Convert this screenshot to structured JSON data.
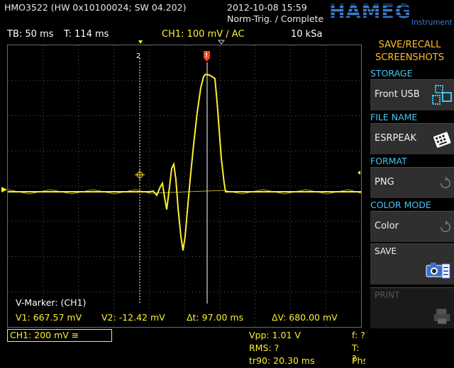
{
  "header": {
    "model": "HMO3522 (HW 0x10100024; SW 04.202)",
    "datetime": "2012-10-08 15:59",
    "trigger_status": "Norm-Trig. / Complete",
    "brand": "HAMEG",
    "brand_sub": "Instruments"
  },
  "info_bar": {
    "timebase": "TB: 50 ms",
    "trigger_time": "T: 114 ms",
    "channel": "CH1: 100 mV ∕ AC",
    "samplerate": "10 kSa"
  },
  "markers": {
    "title": "V-Marker: (CH1)",
    "v1": "V1: 667.57 mV",
    "v2": "V2: -12.42 mV",
    "dt": "Δt: 97.00 ms",
    "dv": "ΔV: 680.00 mV",
    "marker2_label": "2",
    "ch_label": "1"
  },
  "bottom": {
    "ch1_setting": "CH1: 200 mV ≅",
    "vpp": "Vpp: 1.01 V",
    "rms": "RMS: ?",
    "tr90": "tr90: 20.30 ms",
    "freq": "f: ?",
    "period": "T: ?",
    "phase": "Phs: ?"
  },
  "menu": {
    "title1": "SAVE/RECALL",
    "title2": "SCREENSHOTS",
    "storage_label": "STORAGE",
    "storage_value": "Front USB",
    "filename_label": "FILE NAME",
    "filename_value": "ESRPEAK",
    "format_label": "FORMAT",
    "format_value": "PNG",
    "colormode_label": "COLOR MODE",
    "colormode_value": "Color",
    "save_label": "SAVE",
    "print_label": "PRINT"
  },
  "colors": {
    "trace": "#ffef2e",
    "menu_title": "#ffbd28",
    "menu_section": "#46c5f0",
    "grid": "#6b6b6b"
  },
  "icons": [
    "usb-storage-icon",
    "keyboard-icon",
    "cycle-icon",
    "camera-icon",
    "printer-icon",
    "trigger-marker-icon",
    "crosshair-icon"
  ]
}
